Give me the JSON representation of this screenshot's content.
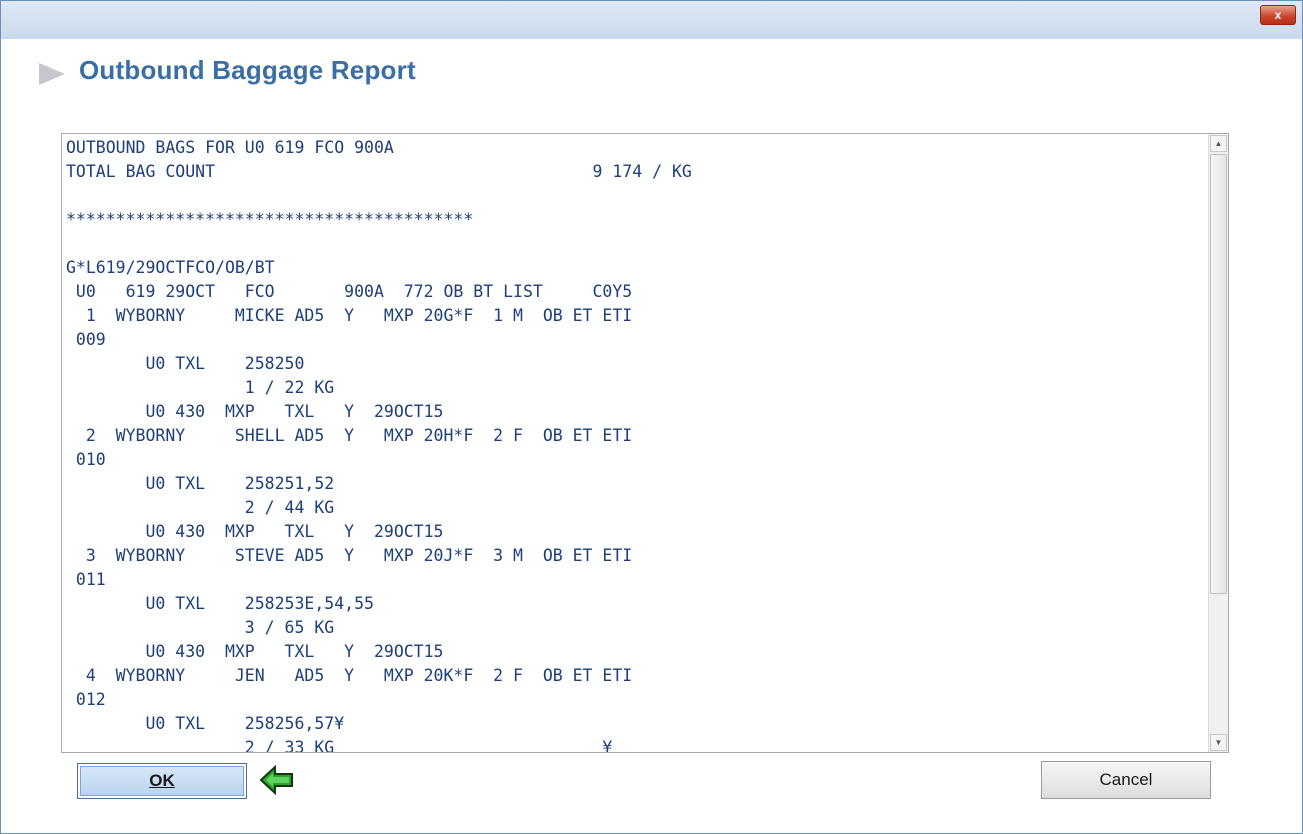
{
  "window": {
    "close_label": "x"
  },
  "header": {
    "title": "Outbound Baggage Report"
  },
  "report": {
    "lines": [
      "OUTBOUND BAGS FOR U0 619 FCO 900A",
      "TOTAL BAG COUNT                                      9 174 / KG",
      "",
      "*****************************************",
      "",
      "G*L619/29OCTFCO/OB/BT",
      " U0   619 29OCT   FCO       900A  772 OB BT LIST     C0Y5",
      "  1  WYBORNY     MICKE AD5  Y   MXP 20G*F  1 M  OB ET ETI",
      " 009",
      "        U0 TXL    258250",
      "                  1 / 22 KG",
      "        U0 430  MXP   TXL   Y  29OCT15",
      "  2  WYBORNY     SHELL AD5  Y   MXP 20H*F  2 F  OB ET ETI",
      " 010",
      "        U0 TXL    258251,52",
      "                  2 / 44 KG",
      "        U0 430  MXP   TXL   Y  29OCT15",
      "  3  WYBORNY     STEVE AD5  Y   MXP 20J*F  3 M  OB ET ETI",
      " 011",
      "        U0 TXL    258253E,54,55",
      "                  3 / 65 KG",
      "        U0 430  MXP   TXL   Y  29OCT15",
      "  4  WYBORNY     JEN   AD5  Y   MXP 20K*F  2 F  OB ET ETI",
      " 012",
      "        U0 TXL    258256,57¥",
      "                  2 / 33 KG                           ¥"
    ]
  },
  "buttons": {
    "ok_label": "OK",
    "cancel_label": "Cancel"
  },
  "colors": {
    "title": "#3b6ea5",
    "report_text": "#1d3f7a",
    "arrow_green": "#2f9e2f"
  }
}
